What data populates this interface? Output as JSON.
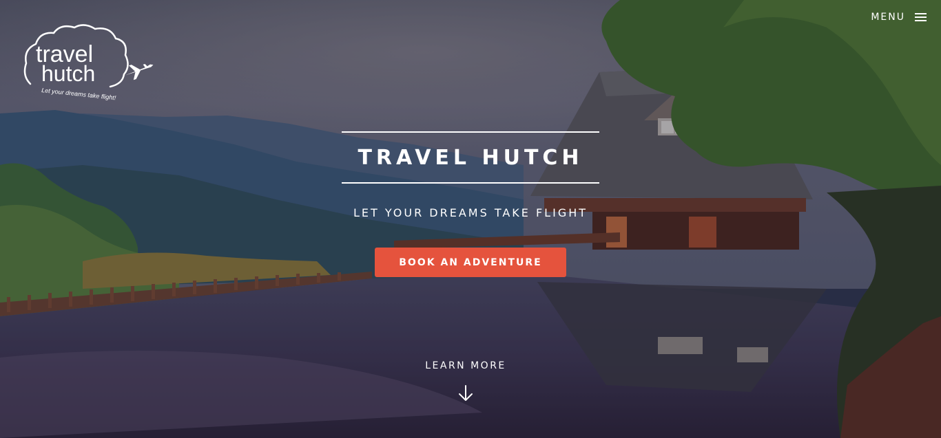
{
  "logo": {
    "line1": "travel",
    "line2": "hutch",
    "slogan": "Let your dreams take flight!"
  },
  "menu": {
    "label": "MENU",
    "icon": "hamburger-icon"
  },
  "hero": {
    "title": "TRAVEL HUTCH",
    "tagline": "LET YOUR DREAMS TAKE FLIGHT",
    "cta_label": "BOOK AN ADVENTURE",
    "learn_more_label": "LEARN MORE",
    "down_icon": "arrow-down-icon"
  },
  "colors": {
    "accent": "#e5533d",
    "text": "#ffffff"
  }
}
